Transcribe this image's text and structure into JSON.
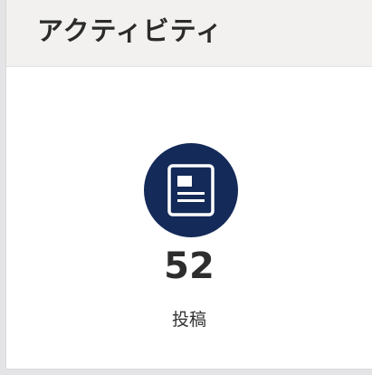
{
  "activity_card": {
    "title": "アクティビティ",
    "stat": {
      "icon": "document-icon",
      "value": "52",
      "label": "投稿"
    }
  },
  "colors": {
    "icon_background": "#142a58",
    "header_background": "#f2f1ef"
  }
}
